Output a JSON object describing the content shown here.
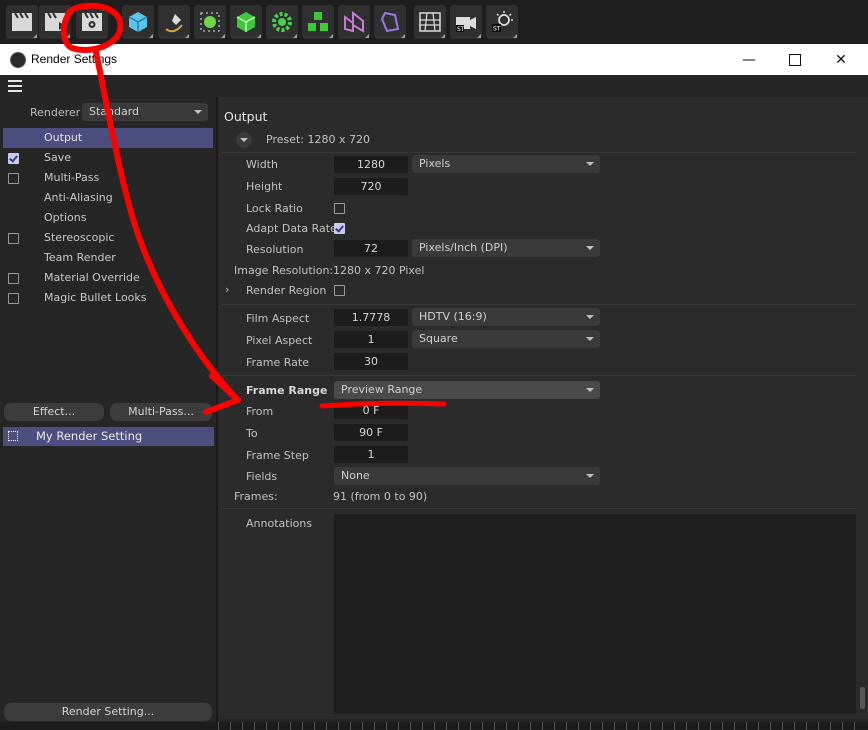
{
  "toolbar": {
    "icons": [
      "render-view-icon",
      "render-picture-viewer-icon",
      "edit-render-settings-icon",
      "cube-icon",
      "pen-icon",
      "subdivision-icon",
      "green-cube-icon",
      "cloner-icon",
      "deformer-icon",
      "spline-icon",
      "polygon-icon",
      "floor-grid-icon",
      "camera-icon",
      "light-icon"
    ]
  },
  "window": {
    "title": "Render Settings"
  },
  "left": {
    "renderer_label": "Renderer",
    "renderer_value": "Standard",
    "items": [
      {
        "label": "Output",
        "checkbox": false,
        "checked": false
      },
      {
        "label": "Save",
        "checkbox": true,
        "checked": true
      },
      {
        "label": "Multi-Pass",
        "checkbox": true,
        "checked": false
      },
      {
        "label": "Anti-Aliasing",
        "checkbox": false,
        "checked": false
      },
      {
        "label": "Options",
        "checkbox": false,
        "checked": false
      },
      {
        "label": "Stereoscopic",
        "checkbox": true,
        "checked": false
      },
      {
        "label": "Team Render",
        "checkbox": false,
        "checked": false
      },
      {
        "label": "Material Override",
        "checkbox": true,
        "checked": false
      },
      {
        "label": "Magic Bullet Looks",
        "checkbox": true,
        "checked": false
      }
    ],
    "effect_button": "Effect...",
    "multipass_button": "Multi-Pass...",
    "setting_name": "My Render Setting",
    "render_setting_button": "Render Setting..."
  },
  "output": {
    "title": "Output",
    "preset": "Preset: 1280 x 720",
    "width_label": "Width",
    "width_value": "1280",
    "width_unit": "Pixels",
    "height_label": "Height",
    "height_value": "720",
    "lock_ratio_label": "Lock Ratio",
    "lock_ratio_checked": false,
    "adapt_label": "Adapt Data Rate",
    "adapt_checked": true,
    "resolution_label": "Resolution",
    "resolution_value": "72",
    "resolution_unit": "Pixels/Inch (DPI)",
    "image_res_label": "Image Resolution:",
    "image_res_value": "1280 x 720 Pixel",
    "render_region_label": "Render Region",
    "render_region_checked": false,
    "film_aspect_label": "Film Aspect",
    "film_aspect_value": "1.7778",
    "film_aspect_preset": "HDTV (16:9)",
    "pixel_aspect_label": "Pixel Aspect",
    "pixel_aspect_value": "1",
    "pixel_aspect_preset": "Square",
    "frame_rate_label": "Frame Rate",
    "frame_rate_value": "30",
    "frame_range_label": "Frame Range",
    "frame_range_value": "Preview Range",
    "from_label": "From",
    "from_value": "0 F",
    "to_label": "To",
    "to_value": "90 F",
    "frame_step_label": "Frame Step",
    "frame_step_value": "1",
    "fields_label": "Fields",
    "fields_value": "None",
    "frames_label": "Frames:",
    "frames_value": "91 (from 0 to 90)",
    "annotations_label": "Annotations"
  },
  "colors": {
    "accent": "#4b4e7e",
    "annotation_red": "#ff0000"
  }
}
